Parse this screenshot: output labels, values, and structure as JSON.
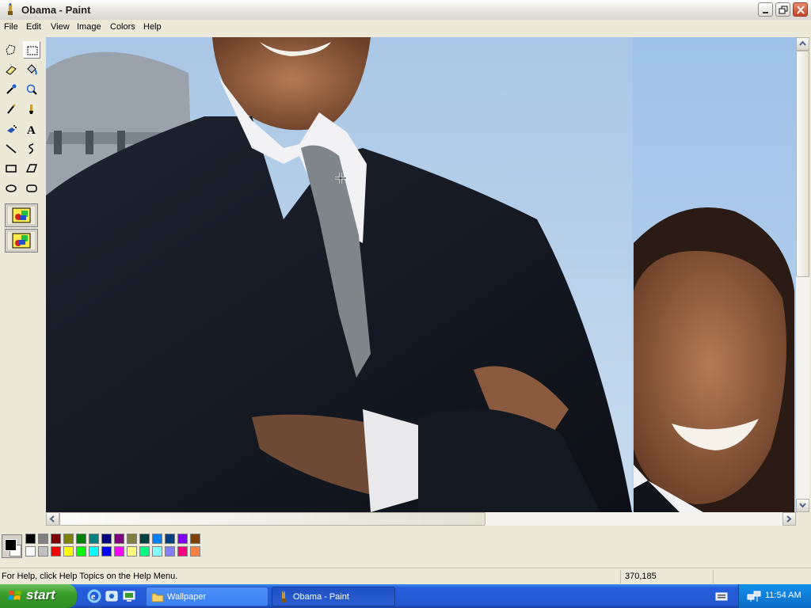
{
  "window": {
    "title": "Obama - Paint"
  },
  "menu": {
    "items": [
      "File",
      "Edit",
      "View",
      "Image",
      "Colors",
      "Help"
    ]
  },
  "tools": [
    "free-form-select",
    "select",
    "eraser",
    "fill-with-color",
    "pick-color",
    "magnifier",
    "pencil",
    "brush",
    "airbrush",
    "text",
    "line",
    "curve",
    "rectangle",
    "polygon",
    "ellipse",
    "rounded-rectangle"
  ],
  "selected_tool": "select",
  "palette": {
    "foreground": "#000000",
    "background": "#ffffff",
    "top_row": [
      "#000000",
      "#808080",
      "#800000",
      "#808000",
      "#008000",
      "#008080",
      "#000080",
      "#800080",
      "#808040",
      "#004040",
      "#0080ff",
      "#004080",
      "#8000ff",
      "#804000"
    ],
    "bottom_row": [
      "#ffffff",
      "#c0c0c0",
      "#ff0000",
      "#ffff00",
      "#00ff00",
      "#00ffff",
      "#0000ff",
      "#ff00ff",
      "#ffff80",
      "#00ff80",
      "#80ffff",
      "#8080ff",
      "#ff0080",
      "#ff8040"
    ]
  },
  "status": {
    "help_text": "For Help, click Help Topics on the Help Menu.",
    "coordinates": "370,185"
  },
  "taskbar": {
    "start_label": "start",
    "tasks": [
      {
        "label": "Wallpaper",
        "icon": "folder-icon"
      },
      {
        "label": "Obama - Paint",
        "icon": "paint-icon"
      }
    ],
    "clock": "11:54 AM"
  }
}
